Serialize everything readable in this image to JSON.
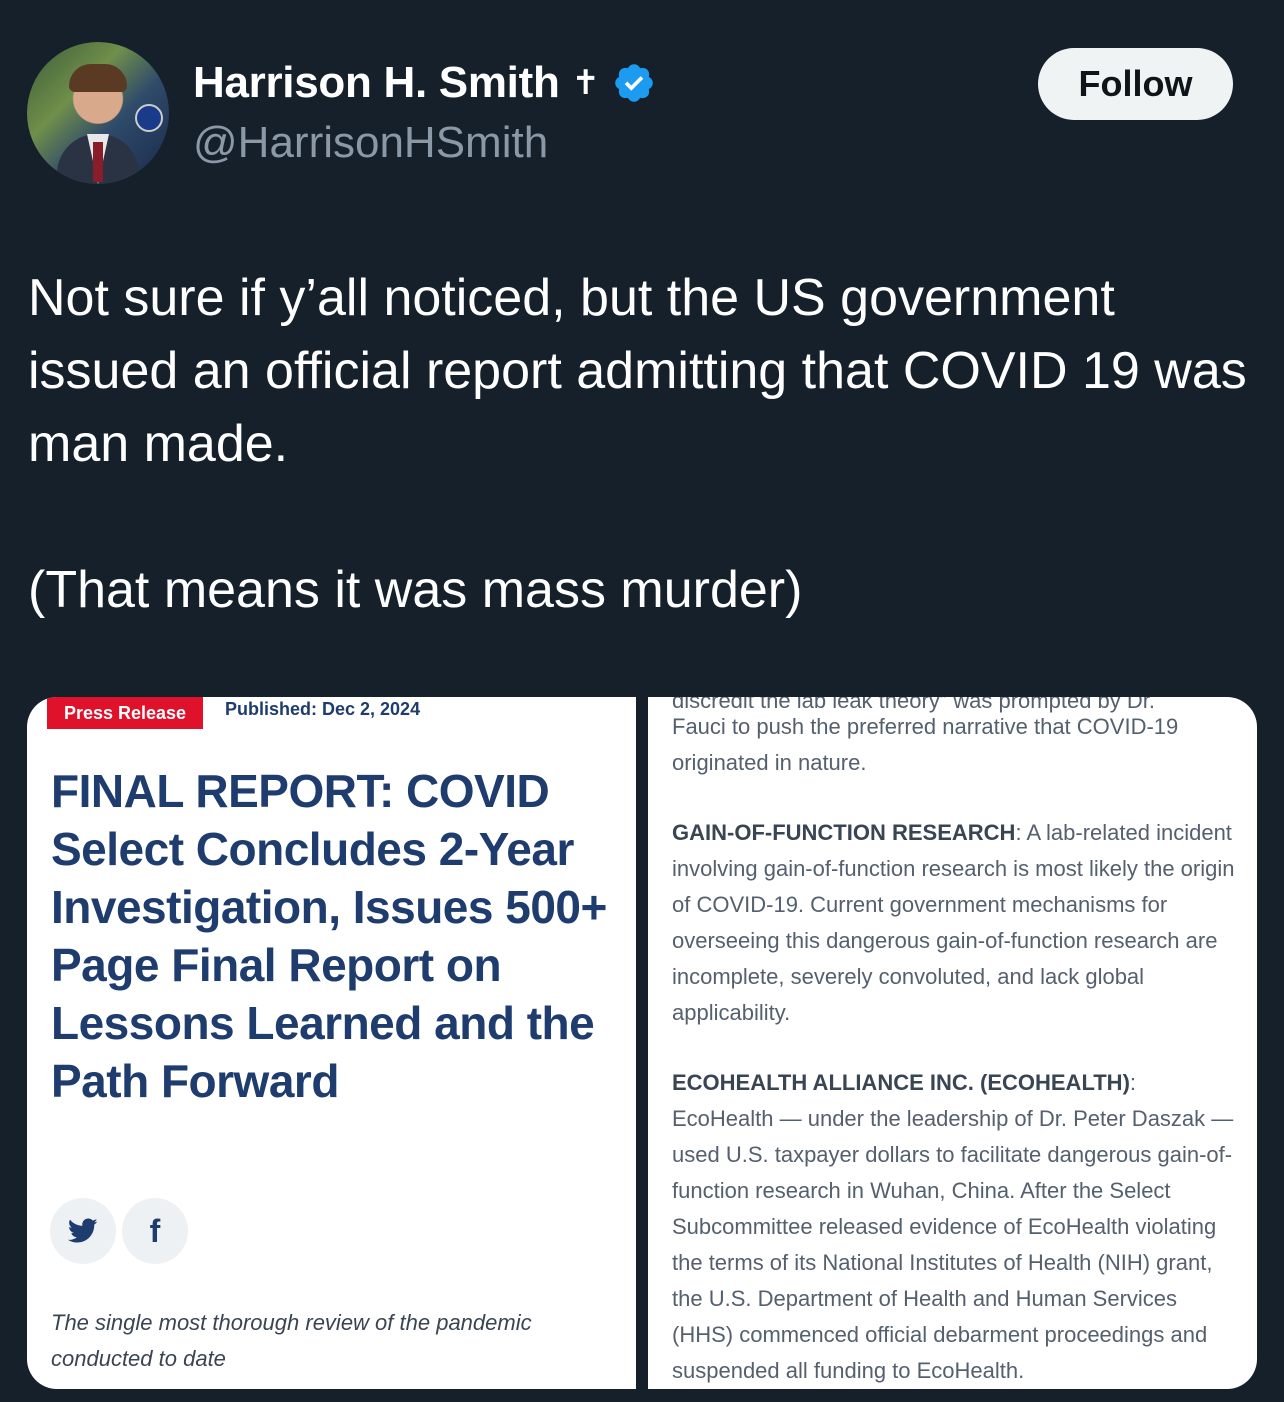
{
  "author": {
    "name": "Harrison H. Smith",
    "handle": "@HarrisonHSmith",
    "cross_glyph": "✝",
    "verified_color": "#1d9bf0"
  },
  "follow_label": "Follow",
  "tweet": {
    "line1": "Not sure if y’all noticed, but the US government issued an official report admitting that COVID 19 was man made.",
    "line2": "(That means it was mass murder)"
  },
  "media": {
    "left": {
      "badge": "Press Release",
      "published": "Published: Dec 2, 2024",
      "title": "FINAL REPORT: COVID Select Concludes 2-Year Investigation, Issues 500+ Page Final Report on Lessons Learned and the Path Forward",
      "subtitle": "The single most thorough review of the pandemic conducted to date"
    },
    "right": {
      "cut_line": "discredit the lab leak theory” was prompted by Dr.",
      "para1": "Fauci to push the preferred narrative that COVID-19 originated in nature.",
      "para2_head": "GAIN-OF-FUNCTION RESEARCH",
      "para2_body": ": A lab-related incident involving gain-of-function research is most likely the origin of COVID-19. Current government mechanisms for overseeing this dangerous gain-of-function research are incomplete, severely convoluted, and lack global applicability.",
      "para3_head": "ECOHEALTH ALLIANCE INC. (ECOHEALTH)",
      "para3_colon": ":",
      "para3_body": "EcoHealth — under the leadership of Dr. Peter Daszak — used U.S. taxpayer dollars to facilitate dangerous gain-of-function research in Wuhan, China. After the Select Subcommittee released evidence of EcoHealth violating the terms of its National Institutes of Health (NIH) grant, the U.S. Department of Health and Human Services (HHS) commenced official debarment proceedings and suspended all funding to EcoHealth."
    }
  }
}
